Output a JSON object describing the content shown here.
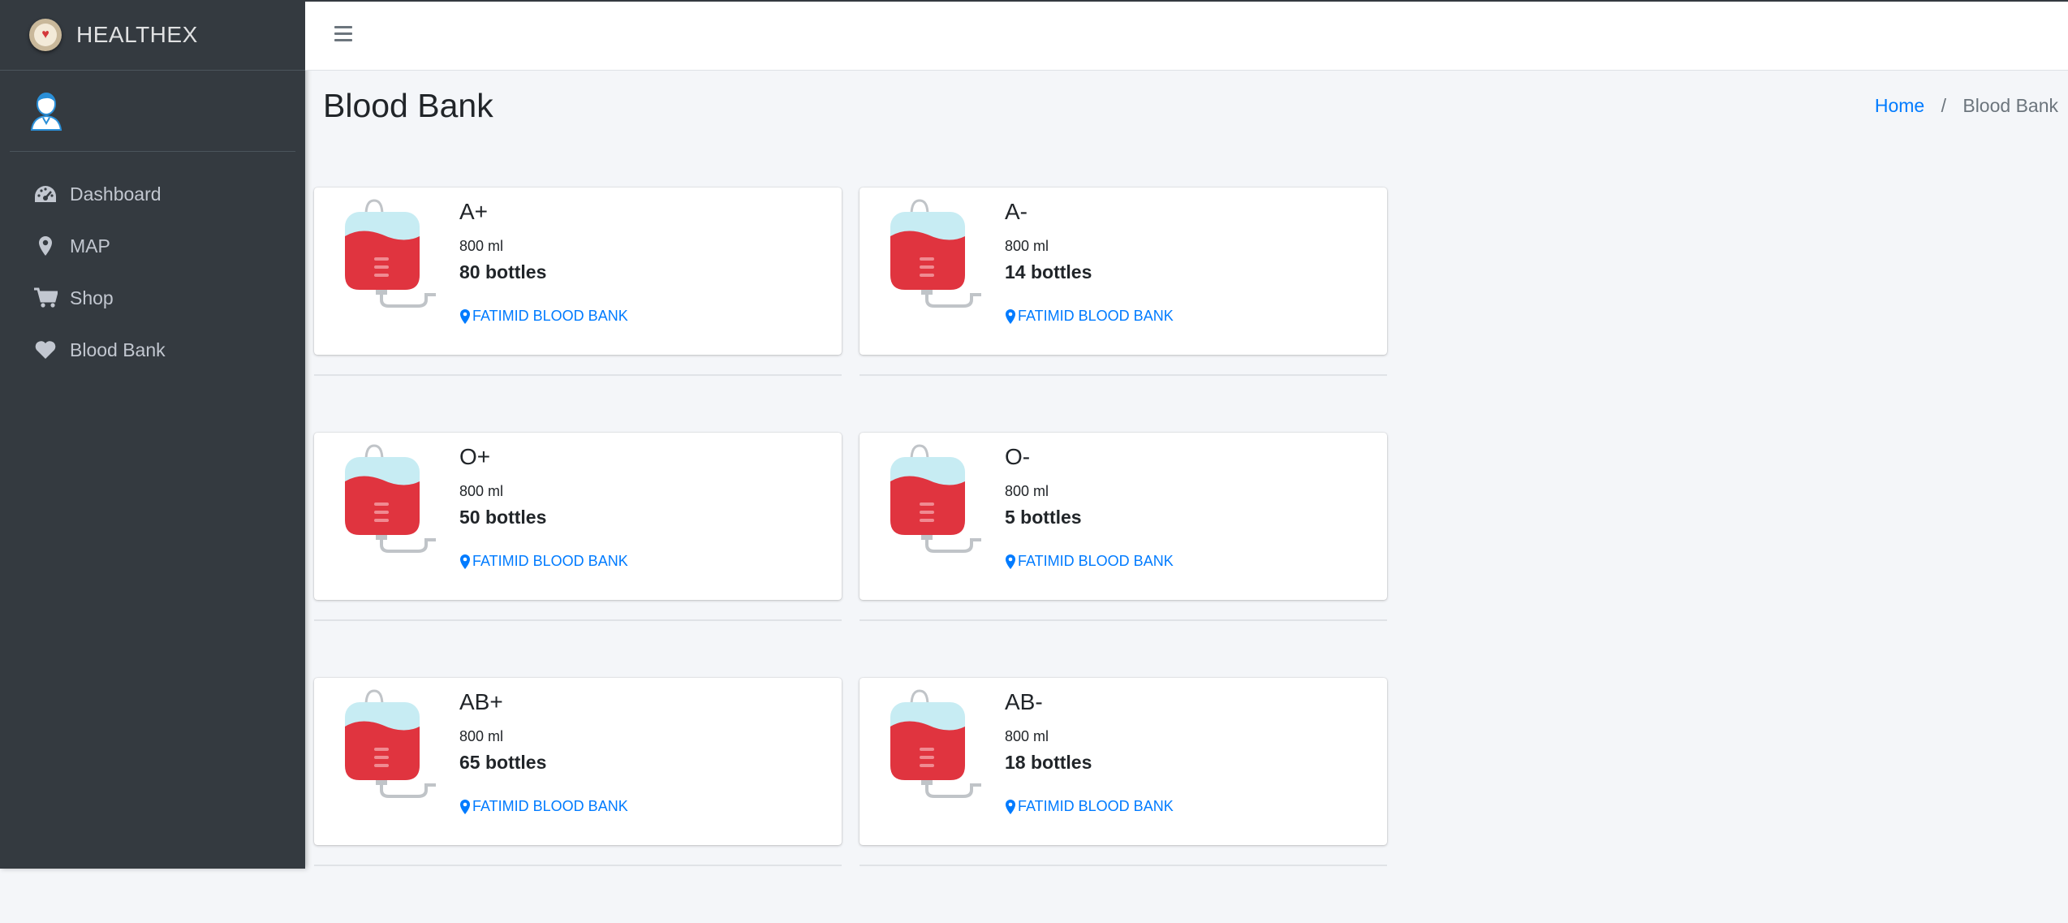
{
  "brand": {
    "name": "HEALTHEX"
  },
  "sidebar": {
    "items": [
      {
        "label": "Dashboard",
        "icon": "tachometer-icon"
      },
      {
        "label": "MAP",
        "icon": "map-marker-icon"
      },
      {
        "label": "Shop",
        "icon": "cart-icon"
      },
      {
        "label": "Blood Bank",
        "icon": "heart-icon"
      }
    ]
  },
  "header": {
    "title": "Blood Bank",
    "breadcrumb": {
      "home": "Home",
      "separator": "/",
      "current": "Blood Bank"
    }
  },
  "cards": [
    {
      "type": "A+",
      "volume": "800 ml",
      "bottles": "80 bottles",
      "location": "FATIMID BLOOD BANK"
    },
    {
      "type": "A-",
      "volume": "800 ml",
      "bottles": "14 bottles",
      "location": "FATIMID BLOOD BANK"
    },
    {
      "type": "O+",
      "volume": "800 ml",
      "bottles": "50 bottles",
      "location": "FATIMID BLOOD BANK"
    },
    {
      "type": "O-",
      "volume": "800 ml",
      "bottles": "5 bottles",
      "location": "FATIMID BLOOD BANK"
    },
    {
      "type": "AB+",
      "volume": "800 ml",
      "bottles": "65 bottles",
      "location": "FATIMID BLOOD BANK"
    },
    {
      "type": "AB-",
      "volume": "800 ml",
      "bottles": "18 bottles",
      "location": "FATIMID BLOOD BANK"
    }
  ],
  "colors": {
    "sidebar_bg": "#343a40",
    "link": "#007bff",
    "blood": "#e0343f",
    "bag_top": "#c7ecf3"
  }
}
